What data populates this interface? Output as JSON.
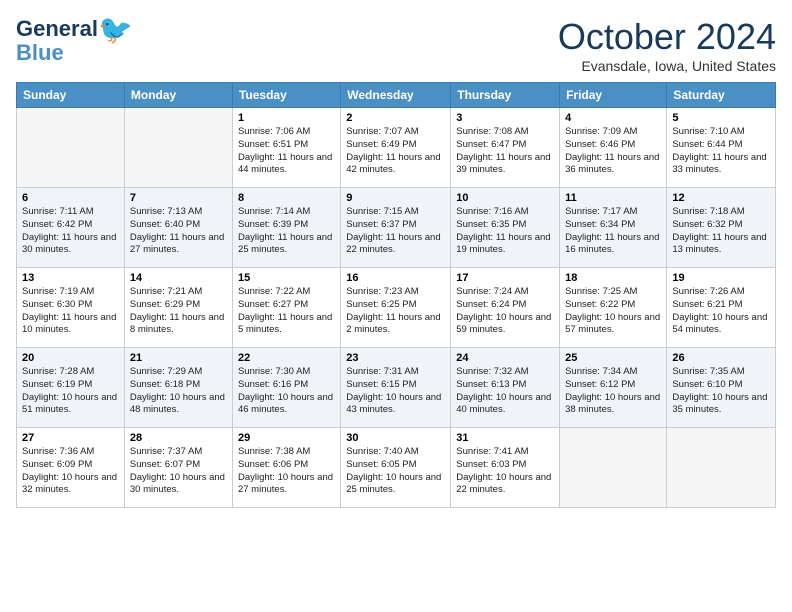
{
  "header": {
    "logo_line1": "General",
    "logo_line2": "Blue",
    "month_title": "October 2024",
    "subtitle": "Evansdale, Iowa, United States"
  },
  "days_of_week": [
    "Sunday",
    "Monday",
    "Tuesday",
    "Wednesday",
    "Thursday",
    "Friday",
    "Saturday"
  ],
  "weeks": [
    [
      {
        "day": "",
        "info": ""
      },
      {
        "day": "",
        "info": ""
      },
      {
        "day": "1",
        "info": "Sunrise: 7:06 AM\nSunset: 6:51 PM\nDaylight: 11 hours and 44 minutes."
      },
      {
        "day": "2",
        "info": "Sunrise: 7:07 AM\nSunset: 6:49 PM\nDaylight: 11 hours and 42 minutes."
      },
      {
        "day": "3",
        "info": "Sunrise: 7:08 AM\nSunset: 6:47 PM\nDaylight: 11 hours and 39 minutes."
      },
      {
        "day": "4",
        "info": "Sunrise: 7:09 AM\nSunset: 6:46 PM\nDaylight: 11 hours and 36 minutes."
      },
      {
        "day": "5",
        "info": "Sunrise: 7:10 AM\nSunset: 6:44 PM\nDaylight: 11 hours and 33 minutes."
      }
    ],
    [
      {
        "day": "6",
        "info": "Sunrise: 7:11 AM\nSunset: 6:42 PM\nDaylight: 11 hours and 30 minutes."
      },
      {
        "day": "7",
        "info": "Sunrise: 7:13 AM\nSunset: 6:40 PM\nDaylight: 11 hours and 27 minutes."
      },
      {
        "day": "8",
        "info": "Sunrise: 7:14 AM\nSunset: 6:39 PM\nDaylight: 11 hours and 25 minutes."
      },
      {
        "day": "9",
        "info": "Sunrise: 7:15 AM\nSunset: 6:37 PM\nDaylight: 11 hours and 22 minutes."
      },
      {
        "day": "10",
        "info": "Sunrise: 7:16 AM\nSunset: 6:35 PM\nDaylight: 11 hours and 19 minutes."
      },
      {
        "day": "11",
        "info": "Sunrise: 7:17 AM\nSunset: 6:34 PM\nDaylight: 11 hours and 16 minutes."
      },
      {
        "day": "12",
        "info": "Sunrise: 7:18 AM\nSunset: 6:32 PM\nDaylight: 11 hours and 13 minutes."
      }
    ],
    [
      {
        "day": "13",
        "info": "Sunrise: 7:19 AM\nSunset: 6:30 PM\nDaylight: 11 hours and 10 minutes."
      },
      {
        "day": "14",
        "info": "Sunrise: 7:21 AM\nSunset: 6:29 PM\nDaylight: 11 hours and 8 minutes."
      },
      {
        "day": "15",
        "info": "Sunrise: 7:22 AM\nSunset: 6:27 PM\nDaylight: 11 hours and 5 minutes."
      },
      {
        "day": "16",
        "info": "Sunrise: 7:23 AM\nSunset: 6:25 PM\nDaylight: 11 hours and 2 minutes."
      },
      {
        "day": "17",
        "info": "Sunrise: 7:24 AM\nSunset: 6:24 PM\nDaylight: 10 hours and 59 minutes."
      },
      {
        "day": "18",
        "info": "Sunrise: 7:25 AM\nSunset: 6:22 PM\nDaylight: 10 hours and 57 minutes."
      },
      {
        "day": "19",
        "info": "Sunrise: 7:26 AM\nSunset: 6:21 PM\nDaylight: 10 hours and 54 minutes."
      }
    ],
    [
      {
        "day": "20",
        "info": "Sunrise: 7:28 AM\nSunset: 6:19 PM\nDaylight: 10 hours and 51 minutes."
      },
      {
        "day": "21",
        "info": "Sunrise: 7:29 AM\nSunset: 6:18 PM\nDaylight: 10 hours and 48 minutes."
      },
      {
        "day": "22",
        "info": "Sunrise: 7:30 AM\nSunset: 6:16 PM\nDaylight: 10 hours and 46 minutes."
      },
      {
        "day": "23",
        "info": "Sunrise: 7:31 AM\nSunset: 6:15 PM\nDaylight: 10 hours and 43 minutes."
      },
      {
        "day": "24",
        "info": "Sunrise: 7:32 AM\nSunset: 6:13 PM\nDaylight: 10 hours and 40 minutes."
      },
      {
        "day": "25",
        "info": "Sunrise: 7:34 AM\nSunset: 6:12 PM\nDaylight: 10 hours and 38 minutes."
      },
      {
        "day": "26",
        "info": "Sunrise: 7:35 AM\nSunset: 6:10 PM\nDaylight: 10 hours and 35 minutes."
      }
    ],
    [
      {
        "day": "27",
        "info": "Sunrise: 7:36 AM\nSunset: 6:09 PM\nDaylight: 10 hours and 32 minutes."
      },
      {
        "day": "28",
        "info": "Sunrise: 7:37 AM\nSunset: 6:07 PM\nDaylight: 10 hours and 30 minutes."
      },
      {
        "day": "29",
        "info": "Sunrise: 7:38 AM\nSunset: 6:06 PM\nDaylight: 10 hours and 27 minutes."
      },
      {
        "day": "30",
        "info": "Sunrise: 7:40 AM\nSunset: 6:05 PM\nDaylight: 10 hours and 25 minutes."
      },
      {
        "day": "31",
        "info": "Sunrise: 7:41 AM\nSunset: 6:03 PM\nDaylight: 10 hours and 22 minutes."
      },
      {
        "day": "",
        "info": ""
      },
      {
        "day": "",
        "info": ""
      }
    ]
  ]
}
